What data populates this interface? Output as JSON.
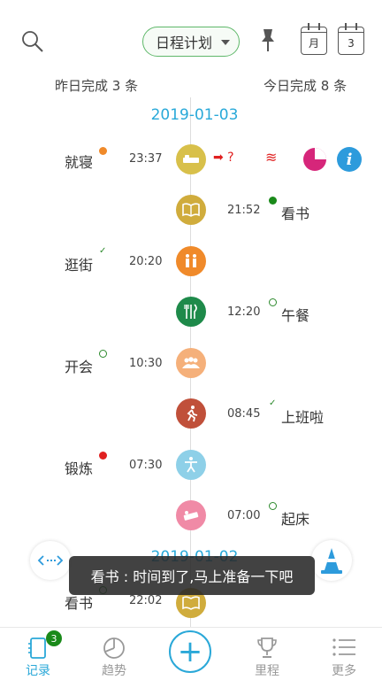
{
  "header": {
    "plan_selector": "日程计划",
    "month_label": "月",
    "day_label": "3"
  },
  "summary": {
    "yesterday": "昨日完成 3 条",
    "today": "今日完成 8 条"
  },
  "dates": {
    "d1": "2019-01-03",
    "d2": "2019-01-02"
  },
  "items": [
    {
      "name": "就寝",
      "time": "23:37"
    },
    {
      "name": "看书",
      "time": "21:52"
    },
    {
      "name": "逛街",
      "time": "20:20"
    },
    {
      "name": "午餐",
      "time": "12:20"
    },
    {
      "name": "开会",
      "time": "10:30"
    },
    {
      "name": "上班啦",
      "time": "08:45"
    },
    {
      "name": "锻炼",
      "time": "07:30"
    },
    {
      "name": "起床",
      "time": "07:00"
    },
    {
      "name": "看书",
      "time": "22:02"
    }
  ],
  "sleep_note": "➡ ?",
  "toast": "看书 : 时间到了,马上准备一下吧",
  "nav": {
    "records": "记录",
    "records_badge": "3",
    "trends": "趋势",
    "milestones": "里程",
    "more": "更多"
  },
  "colors": {
    "accent": "#2aa8d8",
    "sleep": "#d8c04a",
    "read": "#d0ac3c",
    "shopping": "#f08a2a",
    "lunch": "#1e8a4a",
    "meeting": "#f5b07a",
    "work": "#c0503a",
    "exercise": "#8ed0e8",
    "wakeup": "#f08aa6"
  }
}
